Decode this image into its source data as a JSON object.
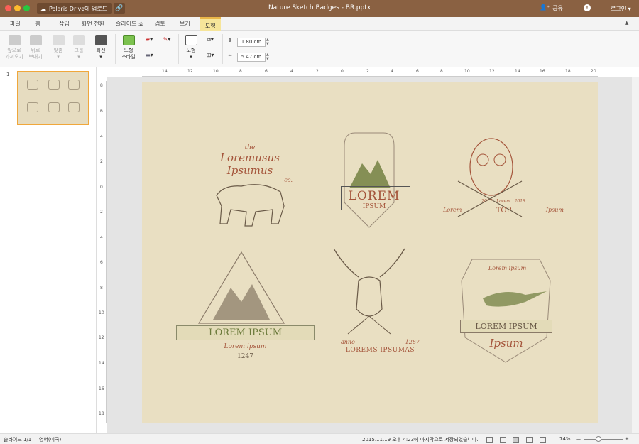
{
  "window": {
    "title": "Nature Sketch Badges - BR.pptx",
    "upload_label": "Polaris Drive에 업로드",
    "share_label": "공유",
    "login_label": "로그인 ▾"
  },
  "menu_tabs": [
    "파일",
    "홈",
    "삽입",
    "화면 전환",
    "슬라이드 쇼",
    "검토",
    "보기",
    "도형"
  ],
  "active_tab": "도형",
  "ribbon": {
    "bring_forward": [
      "앞으로",
      "가져오기"
    ],
    "send_backward": [
      "뒤로",
      "보내기"
    ],
    "align": "맞춤",
    "group": "그룹",
    "rotate": "회전",
    "shape_style": [
      "도형",
      "스타일"
    ],
    "shape": "도형",
    "height": "1.80 cm",
    "width": "5.47 cm"
  },
  "slide_panel": {
    "slide_number": "1"
  },
  "ruler": {
    "horizontal": [
      "14",
      "12",
      "10",
      "8",
      "6",
      "4",
      "2",
      "0",
      "2",
      "4",
      "6",
      "8",
      "10",
      "12",
      "14",
      "16",
      "18",
      "20"
    ],
    "vertical": [
      "8",
      "6",
      "4",
      "2",
      "0",
      "2",
      "4",
      "6",
      "8",
      "10",
      "12",
      "14",
      "16",
      "18"
    ]
  },
  "slide": {
    "badge_loremusus": {
      "line1": "the",
      "line2": "Loremusus",
      "line3": "Ipsumus",
      "line4": "co."
    },
    "badge_mountain_top": {
      "title": "LOREM",
      "sub": "IPSUM"
    },
    "badge_owl": {
      "top": "TOP",
      "left": "Lorem",
      "right": "Ipsum",
      "n1": "2017",
      "n2": "Lorem",
      "n3": "2018"
    },
    "badge_mountain_left": {
      "title": "LOREM IPSUM",
      "sub": "Lorem ipsum",
      "year": "1247"
    },
    "badge_deer": {
      "left": "anno",
      "right": "1267",
      "title": "LOREMS IPSUMAS"
    },
    "badge_pheasant": {
      "top": "Lorem ipsum",
      "title": "LOREM IPSUM",
      "sub": "Ipsum"
    }
  },
  "status": {
    "slide_count": "슬라이드 1/1",
    "language": "영어(미국)",
    "saved": "2015.11.19 오후 4:23에 마지막으로 저장되었습니다.",
    "zoom": "74%",
    "zoom_out": "—",
    "zoom_in": "+"
  },
  "colors": {
    "titlebar": "#8a6142",
    "active_tab": "#f6e59a",
    "slide_bg": "#e9dfc2",
    "badge_red": "#a4543a",
    "badge_green": "#6b7a3a",
    "thumb_border": "#f0a73b"
  }
}
